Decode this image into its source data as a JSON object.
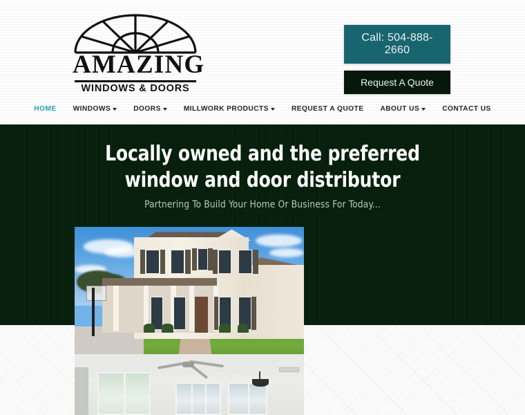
{
  "logo": {
    "icon": "fan-arch-window-icon",
    "wordmark": "AMAZING",
    "tagline": "WINDOWS & DOORS"
  },
  "header": {
    "call_button": "Call: 504-888-2660",
    "quote_button": "Request A Quote",
    "call_button_color": "#186570",
    "quote_button_color": "#07180b"
  },
  "nav": {
    "items": [
      {
        "label": "HOME",
        "has_dropdown": false,
        "active": true
      },
      {
        "label": "WINDOWS",
        "has_dropdown": true,
        "active": false
      },
      {
        "label": "DOORS",
        "has_dropdown": true,
        "active": false
      },
      {
        "label": "MILLWORK PRODUCTS",
        "has_dropdown": true,
        "active": false
      },
      {
        "label": "REQUEST A QUOTE",
        "has_dropdown": false,
        "active": false
      },
      {
        "label": "ABOUT US",
        "has_dropdown": true,
        "active": false
      },
      {
        "label": "CONTACT US",
        "has_dropdown": false,
        "active": false
      }
    ],
    "active_color": "#27a3bd",
    "inactive_color": "#252525"
  },
  "hero": {
    "title_line1": "Locally owned and the preferred",
    "title_line2": "window and door distributor",
    "subtitle": "Partnering To Build Your Home Or Business For Today...",
    "background_color": "#07200c",
    "title_color": "#ffffff",
    "subtitle_color": "#b9c9b6"
  },
  "gallery": {
    "exterior": {
      "alt": "Two-story white traditional house with covered porch, columns, shuttered windows, green lawn and brick walkway under blue sky"
    },
    "interior": {
      "alt": "Bright empty interior room with ceiling fan, sliding glass door and multiple white-framed windows"
    }
  }
}
